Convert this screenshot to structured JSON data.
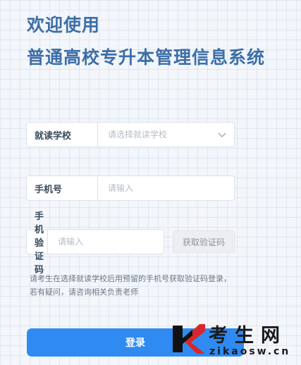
{
  "header": {
    "welcome": "欢迎使用",
    "system_name": "普通高校专升本管理信息系统"
  },
  "form": {
    "school": {
      "label": "就读学校",
      "placeholder": "请选择就读学校"
    },
    "phone": {
      "label": "手机号",
      "placeholder": "请输入"
    },
    "code": {
      "label": "手机验证码",
      "placeholder": "请输入",
      "button": "获取验证码"
    }
  },
  "hint": {
    "line1": "请考生在选择就读学校后用预留的手机号获取验证码登录，",
    "line2": "若有疑问，请咨询相关负责老师"
  },
  "login_label": "登录",
  "watermark": {
    "name": "考生网",
    "url": "zikaosw.cn"
  },
  "colors": {
    "title": "#3d6fa8",
    "primary_button": "#2f8bf2",
    "watermark_red": "#d9262c"
  }
}
